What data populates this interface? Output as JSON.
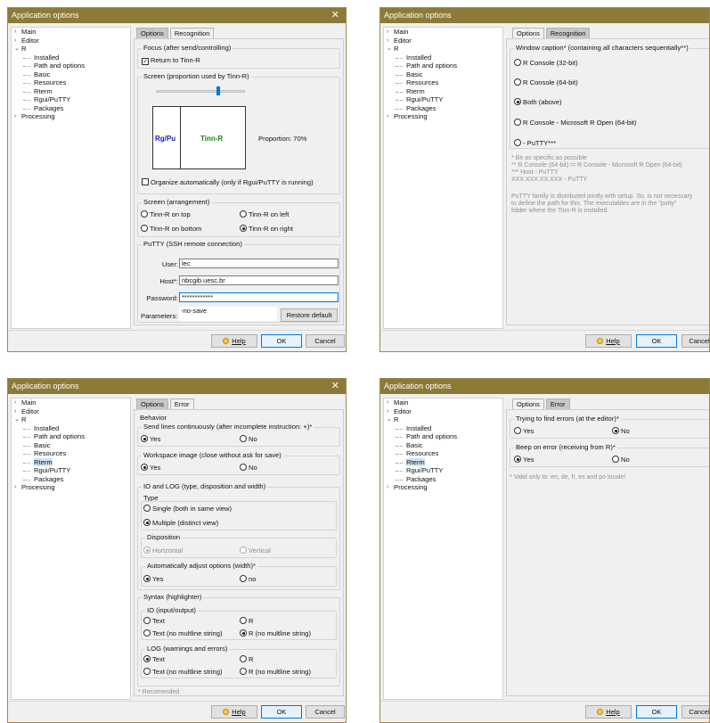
{
  "dialog_title": "Application options",
  "close_glyph": "✕",
  "tree": [
    {
      "label": "Main",
      "chev": "›"
    },
    {
      "label": "Editor",
      "chev": "›"
    },
    {
      "label": "R",
      "chev": "⌄"
    },
    {
      "label": "Installed"
    },
    {
      "label": "Path and options"
    },
    {
      "label": "Basic"
    },
    {
      "label": "Resources"
    },
    {
      "label": "Rterm"
    },
    {
      "label": "Rgui/PuTTY"
    },
    {
      "label": "Packages"
    },
    {
      "label": "Processing",
      "chev": "›"
    }
  ],
  "buttons": {
    "help": "Help",
    "help_icon": "lightbulb-icon",
    "ok": "OK",
    "cancel": "Cancel"
  },
  "p1": {
    "tabs": [
      "Options",
      "Recognition"
    ],
    "focus": {
      "title": "Focus (after send/controlling)",
      "check": "Return to Tinn-R",
      "check_mark": "✓"
    },
    "screen": {
      "title": "Screen (proportion used by Tinn-R)",
      "left": "Rg/Pu",
      "right": "Tinn-R",
      "proportion": "Proportion: 70%",
      "proportion_value": 70,
      "organize": "Organize automatically (only if Rgui/PuTTY is running)"
    },
    "arr": {
      "title": "Screen (arrangement)",
      "opts": [
        "Tinn-R on top",
        "Tinn-R on left",
        "Tinn-R on bottom",
        "Tinn-R on right"
      ]
    },
    "putty": {
      "title": "PuTTY (SSH remote connection)",
      "user_label": "User:",
      "user": "lec",
      "host_label": "Host*:",
      "host": "nbcgib.uesc.br",
      "pass_label": "Password:",
      "pass": "************",
      "params_label": "Parameters:",
      "params": "-no-save",
      "restore": "Restore default"
    }
  },
  "p2": {
    "tabs": [
      "Options",
      "Recognition"
    ],
    "caption": "Window caption* (containing all characters sequentially**)",
    "opts": [
      "R Console (32-bit)",
      "R Console (64-bit)",
      "Both (above)",
      "R Console - Microsoft R Open (64-bit)",
      "- PuTTY***"
    ],
    "notes": [
      "*    Be as specific as possible",
      "**  R Console (64-bit)  != R Console - Microsoft R Open (64-bit)",
      "*** Host - PuTTY",
      "       XXX.XXX.XX.XXX - PuTTY"
    ],
    "para1": "PuTTY family is distributed jointly with setup. So, is not necessary",
    "para2": "to define the path for this. The executables are in the \"putty\"",
    "para3": "folder where the Tinn-R is installed."
  },
  "p3": {
    "tabs": [
      "Options",
      "Error"
    ],
    "behavior": "Behavior",
    "send": "Send lines continuously (after incomplete instruction: +)*",
    "workspace": "Workspace image (close without ask for save)",
    "yes": "Yes",
    "no": "No",
    "no_lc": "no",
    "io": "IO and LOG (type, disposition and width)",
    "type": "Type",
    "single": "Single (both in same view)",
    "multiple": "Multiple (distinct view)",
    "disposition": "Disposition",
    "horizontal": "Horizontal",
    "vertical": "Vertical",
    "adjust": "Automatically adjust options (width)*",
    "syntax": "Syntax (highlighter)",
    "io_inout": "IO (input/output)",
    "log": "LOG (warnings and errors)",
    "text": "Text",
    "r": "R",
    "text_nm": "Text (no multline string)",
    "r_nm": "R (no multline string)",
    "foot": "* Recomended"
  },
  "p4": {
    "tabs": [
      "Options",
      "Error"
    ],
    "find": "Trying to find errors (at the editor)*",
    "beep": "Beep on error (receiving from R)*",
    "yes": "Yes",
    "no": "No",
    "note": "* Valid only to: en, de, fr, es and po locale!"
  }
}
